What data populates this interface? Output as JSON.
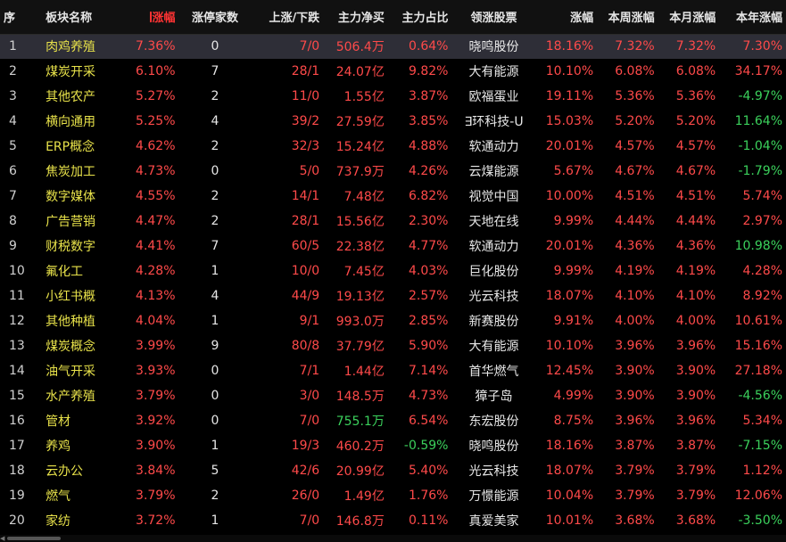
{
  "headers": [
    "序",
    "板块名称",
    "涨幅",
    "涨停家数",
    "上涨/下跌",
    "主力净买",
    "主力占比",
    "领涨股票",
    "涨幅",
    "本周涨幅",
    "本月涨幅",
    "本年涨幅"
  ],
  "colors": {
    "up": "#ff4a4a",
    "down": "#3bd15c",
    "name": "#e8e24a",
    "selected_row": "#2e2e37"
  },
  "rows": [
    {
      "idx": "1",
      "name": "肉鸡养殖",
      "pct": "7.36%",
      "limit": "0",
      "updown": "7/0",
      "net": "506.4万",
      "net_dir": "up",
      "ratio": "0.64%",
      "ratio_dir": "up",
      "stock": "晓鸣股份",
      "spct": "18.16%",
      "week": "7.32%",
      "month": "7.32%",
      "year": "7.30%",
      "year_dir": "up"
    },
    {
      "idx": "2",
      "name": "煤炭开采",
      "pct": "6.10%",
      "limit": "7",
      "updown": "28/1",
      "net": "24.07亿",
      "net_dir": "up",
      "ratio": "9.82%",
      "ratio_dir": "up",
      "stock": "大有能源",
      "spct": "10.10%",
      "week": "6.08%",
      "month": "6.08%",
      "year": "34.17%",
      "year_dir": "up"
    },
    {
      "idx": "3",
      "name": "其他农产",
      "pct": "5.27%",
      "limit": "2",
      "updown": "11/0",
      "net": "1.55亿",
      "net_dir": "up",
      "ratio": "3.87%",
      "ratio_dir": "up",
      "stock": "欧福蛋业",
      "spct": "19.11%",
      "week": "5.36%",
      "month": "5.36%",
      "year": "-4.97%",
      "year_dir": "down"
    },
    {
      "idx": "4",
      "name": "横向通用",
      "pct": "5.25%",
      "limit": "4",
      "updown": "39/2",
      "net": "27.59亿",
      "net_dir": "up",
      "ratio": "3.85%",
      "ratio_dir": "up",
      "stock": "∃环科技-U",
      "spct": "15.03%",
      "week": "5.20%",
      "month": "5.20%",
      "year": "11.64%",
      "year_dir": "down"
    },
    {
      "idx": "5",
      "name": "ERP概念",
      "pct": "4.62%",
      "limit": "2",
      "updown": "32/3",
      "net": "15.24亿",
      "net_dir": "up",
      "ratio": "4.88%",
      "ratio_dir": "up",
      "stock": "软通动力",
      "spct": "20.01%",
      "week": "4.57%",
      "month": "4.57%",
      "year": "-1.04%",
      "year_dir": "down"
    },
    {
      "idx": "6",
      "name": "焦炭加工",
      "pct": "4.73%",
      "limit": "0",
      "updown": "5/0",
      "net": "737.9万",
      "net_dir": "up",
      "ratio": "4.26%",
      "ratio_dir": "up",
      "stock": "云煤能源",
      "spct": "5.67%",
      "week": "4.67%",
      "month": "4.67%",
      "year": "-1.79%",
      "year_dir": "down"
    },
    {
      "idx": "7",
      "name": "数字媒体",
      "pct": "4.55%",
      "limit": "2",
      "updown": "14/1",
      "net": "7.48亿",
      "net_dir": "up",
      "ratio": "6.82%",
      "ratio_dir": "up",
      "stock": "视觉中国",
      "spct": "10.00%",
      "week": "4.51%",
      "month": "4.51%",
      "year": "5.74%",
      "year_dir": "up"
    },
    {
      "idx": "8",
      "name": "广告营销",
      "pct": "4.47%",
      "limit": "2",
      "updown": "28/1",
      "net": "15.56亿",
      "net_dir": "up",
      "ratio": "2.30%",
      "ratio_dir": "up",
      "stock": "天地在线",
      "spct": "9.99%",
      "week": "4.44%",
      "month": "4.44%",
      "year": "2.97%",
      "year_dir": "up"
    },
    {
      "idx": "9",
      "name": "财税数字",
      "pct": "4.41%",
      "limit": "7",
      "updown": "60/5",
      "net": "22.38亿",
      "net_dir": "up",
      "ratio": "4.77%",
      "ratio_dir": "up",
      "stock": "软通动力",
      "spct": "20.01%",
      "week": "4.36%",
      "month": "4.36%",
      "year": "10.98%",
      "year_dir": "down"
    },
    {
      "idx": "10",
      "name": "氟化工",
      "pct": "4.28%",
      "limit": "1",
      "updown": "10/0",
      "net": "7.45亿",
      "net_dir": "up",
      "ratio": "4.03%",
      "ratio_dir": "up",
      "stock": "巨化股份",
      "spct": "9.99%",
      "week": "4.19%",
      "month": "4.19%",
      "year": "4.28%",
      "year_dir": "up"
    },
    {
      "idx": "11",
      "name": "小红书概",
      "pct": "4.13%",
      "limit": "4",
      "updown": "44/9",
      "net": "19.13亿",
      "net_dir": "up",
      "ratio": "2.57%",
      "ratio_dir": "up",
      "stock": "光云科技",
      "spct": "18.07%",
      "week": "4.10%",
      "month": "4.10%",
      "year": "8.92%",
      "year_dir": "up"
    },
    {
      "idx": "12",
      "name": "其他种植",
      "pct": "4.04%",
      "limit": "1",
      "updown": "9/1",
      "net": "993.0万",
      "net_dir": "up",
      "ratio": "2.85%",
      "ratio_dir": "up",
      "stock": "新赛股份",
      "spct": "9.91%",
      "week": "4.00%",
      "month": "4.00%",
      "year": "10.61%",
      "year_dir": "up"
    },
    {
      "idx": "13",
      "name": "煤炭概念",
      "pct": "3.99%",
      "limit": "9",
      "updown": "80/8",
      "net": "37.79亿",
      "net_dir": "up",
      "ratio": "5.90%",
      "ratio_dir": "up",
      "stock": "大有能源",
      "spct": "10.10%",
      "week": "3.96%",
      "month": "3.96%",
      "year": "15.16%",
      "year_dir": "up"
    },
    {
      "idx": "14",
      "name": "油气开采",
      "pct": "3.93%",
      "limit": "0",
      "updown": "7/1",
      "net": "1.44亿",
      "net_dir": "up",
      "ratio": "7.14%",
      "ratio_dir": "up",
      "stock": "首华燃气",
      "spct": "12.45%",
      "week": "3.90%",
      "month": "3.90%",
      "year": "27.18%",
      "year_dir": "up"
    },
    {
      "idx": "15",
      "name": "水产养殖",
      "pct": "3.79%",
      "limit": "0",
      "updown": "3/0",
      "net": "148.5万",
      "net_dir": "up",
      "ratio": "4.73%",
      "ratio_dir": "up",
      "stock": "獐子岛",
      "spct": "4.99%",
      "week": "3.90%",
      "month": "3.90%",
      "year": "-4.56%",
      "year_dir": "down"
    },
    {
      "idx": "16",
      "name": "管材",
      "pct": "3.92%",
      "limit": "0",
      "updown": "7/0",
      "net": "755.1万",
      "net_dir": "down",
      "ratio": "6.54%",
      "ratio_dir": "up",
      "stock": "东宏股份",
      "spct": "8.75%",
      "week": "3.96%",
      "month": "3.96%",
      "year": "5.34%",
      "year_dir": "up"
    },
    {
      "idx": "17",
      "name": "养鸡",
      "pct": "3.90%",
      "limit": "1",
      "updown": "19/3",
      "net": "460.2万",
      "net_dir": "up",
      "ratio": "-0.59%",
      "ratio_dir": "down",
      "stock": "晓鸣股份",
      "spct": "18.16%",
      "week": "3.87%",
      "month": "3.87%",
      "year": "-7.15%",
      "year_dir": "down"
    },
    {
      "idx": "18",
      "name": "云办公",
      "pct": "3.84%",
      "limit": "5",
      "updown": "42/6",
      "net": "20.99亿",
      "net_dir": "up",
      "ratio": "5.40%",
      "ratio_dir": "up",
      "stock": "光云科技",
      "spct": "18.07%",
      "week": "3.79%",
      "month": "3.79%",
      "year": "1.12%",
      "year_dir": "up"
    },
    {
      "idx": "19",
      "name": "燃气",
      "pct": "3.79%",
      "limit": "2",
      "updown": "26/0",
      "net": "1.49亿",
      "net_dir": "up",
      "ratio": "1.76%",
      "ratio_dir": "up",
      "stock": "万憬能源",
      "spct": "10.04%",
      "week": "3.79%",
      "month": "3.79%",
      "year": "12.06%",
      "year_dir": "up"
    },
    {
      "idx": "20",
      "name": "家纺",
      "pct": "3.72%",
      "limit": "1",
      "updown": "7/0",
      "net": "146.8万",
      "net_dir": "up",
      "ratio": "0.11%",
      "ratio_dir": "up",
      "stock": "真爱美家",
      "spct": "10.01%",
      "week": "3.68%",
      "month": "3.68%",
      "year": "-3.50%",
      "year_dir": "down"
    }
  ]
}
